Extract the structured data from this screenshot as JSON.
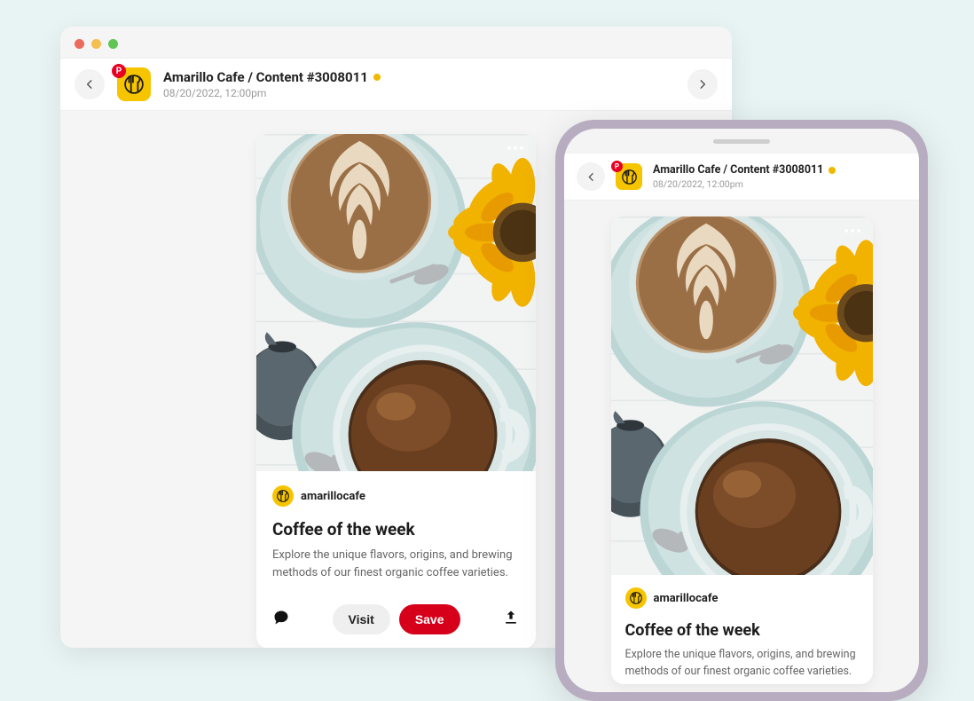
{
  "header": {
    "title": "Amarillo Cafe / Content #3008011",
    "subtitle": "08/20/2022, 12:00pm",
    "status_color": "#f0b800"
  },
  "account": {
    "handle": "amarillocafe"
  },
  "pin": {
    "title": "Coffee of the week",
    "description": "Explore the unique flavors, origins, and brewing methods of our finest organic coffee varieties."
  },
  "actions": {
    "visit_label": "Visit",
    "save_label": "Save"
  },
  "pinterest_badge": "P"
}
